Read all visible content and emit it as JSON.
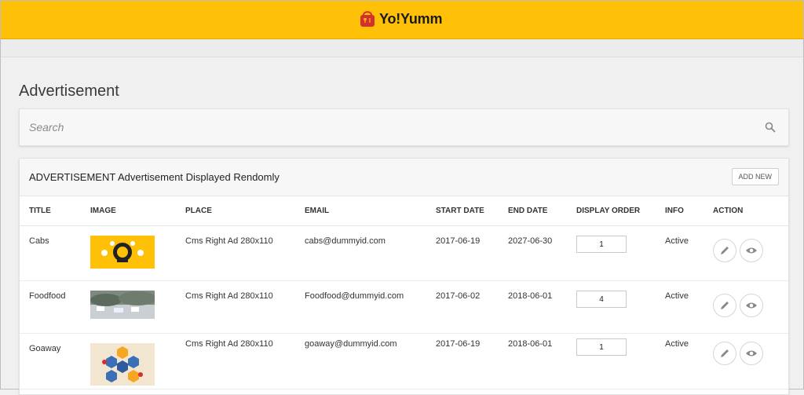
{
  "brand": {
    "name": "Yo!Yumm",
    "brand_color": "#ffc107"
  },
  "page": {
    "title": "Advertisement"
  },
  "search": {
    "placeholder": "Search"
  },
  "card": {
    "title_prefix": "ADVERTISEMENT",
    "title_suffix": "Advertisement Displayed Rendomly",
    "add_button": "ADD NEW"
  },
  "table": {
    "headers": [
      "TITLE",
      "IMAGE",
      "PLACE",
      "EMAIL",
      "START DATE",
      "END DATE",
      "DISPLAY ORDER",
      "INFO",
      "ACTION"
    ],
    "rows": [
      {
        "title": "Cabs",
        "image": "cabs-ad-thumbnail",
        "place": "Cms Right Ad 280x110",
        "email": "cabs@dummyid.com",
        "start_date": "2017-06-19",
        "end_date": "2027-06-30",
        "display_order": "1",
        "info": "Active"
      },
      {
        "title": "Foodfood",
        "image": "foodfood-ad-thumbnail",
        "place": "Cms Right Ad 280x110",
        "email": "Foodfood@dummyid.com",
        "start_date": "2017-06-02",
        "end_date": "2018-06-01",
        "display_order": "4",
        "info": "Active"
      },
      {
        "title": "Goaway",
        "image": "goaway-ad-thumbnail",
        "place": "Cms Right Ad 280x110",
        "email": "goaway@dummyid.com",
        "start_date": "2017-06-19",
        "end_date": "2018-06-01",
        "display_order": "1",
        "info": "Active"
      }
    ]
  },
  "icons": {
    "search": "search-icon",
    "edit": "pencil-icon",
    "view": "eye-icon",
    "logo": "shopping-bag-icon"
  }
}
